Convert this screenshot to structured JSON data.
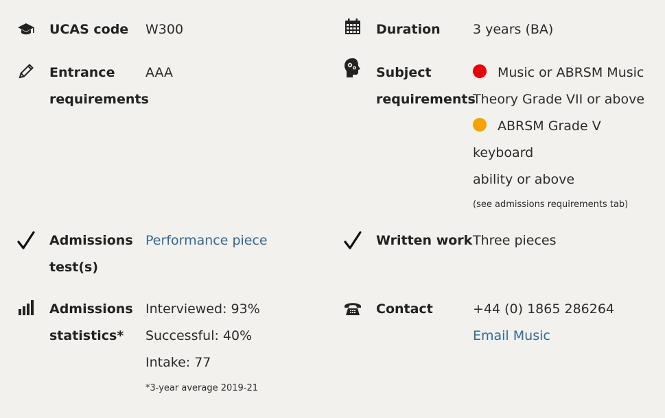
{
  "ucas": {
    "icon": "graduation-cap-icon",
    "label": "UCAS code",
    "value": "W300"
  },
  "duration": {
    "icon": "calendar-icon",
    "label": "Duration",
    "value": "3 years (BA)"
  },
  "entrance": {
    "icon": "pencil-icon",
    "label_line1": "Entrance",
    "label_line2": "requirements",
    "value": "AAA"
  },
  "subject": {
    "icon": "head-gears-icon",
    "label_line1": "Subject",
    "label_line2": "requirements",
    "items": [
      {
        "dot_color": "#e8000b",
        "line1": "Music or ABRSM Music",
        "line2": "Theory Grade VII or above"
      },
      {
        "dot_color": "#f5a300",
        "line1": "ABRSM Grade V keyboard",
        "line2": "ability or above"
      }
    ],
    "note": "(see admissions requirements tab)"
  },
  "admissions_tests": {
    "icon": "checkmark-icon",
    "label_line1": "Admissions",
    "label_line2": "test(s)",
    "link": "Performance piece"
  },
  "written_work": {
    "icon": "checkmark-icon",
    "label": "Written work",
    "value": "Three pieces"
  },
  "stats": {
    "icon": "bar-chart-icon",
    "label_line1": "Admissions",
    "label_line2": "statistics*",
    "interviewed": "Interviewed: 93%",
    "successful": "Successful: 40%",
    "intake": "Intake: 77",
    "footnote": "*3-year average 2019-21"
  },
  "contact": {
    "icon": "telephone-icon",
    "label": "Contact",
    "phone": "+44 (0) 1865 286264",
    "email_link": "Email Music"
  },
  "colors": {
    "link": "#2f6a96",
    "background": "#f2f1ed",
    "dot_red": "#e8000b",
    "dot_orange": "#f5a300"
  }
}
